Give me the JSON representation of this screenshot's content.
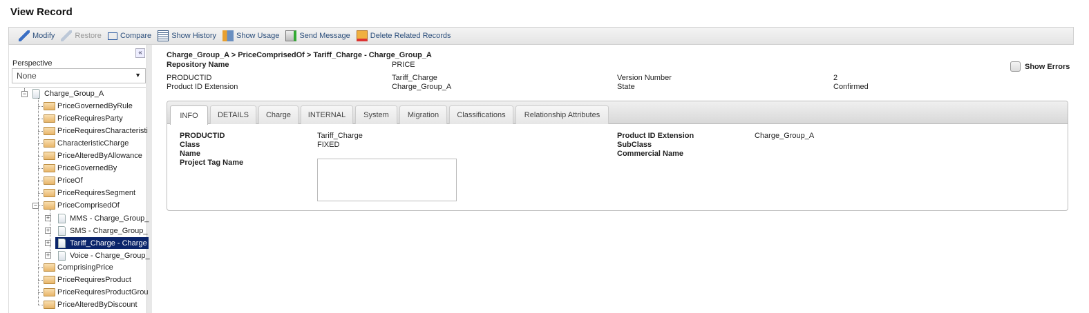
{
  "title": "View Record",
  "toolbar": [
    {
      "label": "Modify",
      "icon": "pencil-icon",
      "enabled": true
    },
    {
      "label": "Restore",
      "icon": "pencil-disabled-icon",
      "enabled": false
    },
    {
      "label": "Compare",
      "icon": "compare-icon",
      "enabled": true
    },
    {
      "label": "Show History",
      "icon": "history-icon",
      "enabled": true
    },
    {
      "label": "Show Usage",
      "icon": "usage-icon",
      "enabled": true
    },
    {
      "label": "Send Message",
      "icon": "send-message-icon",
      "enabled": true
    },
    {
      "label": "Delete Related Records",
      "icon": "delete-records-icon",
      "enabled": true
    }
  ],
  "sidebar": {
    "collapse": "«",
    "perspective_label": "Perspective",
    "perspective_value": "None",
    "tree": {
      "root": "Charge_Group_A",
      "children": [
        "PriceGovernedByRule",
        "PriceRequiresParty",
        "PriceRequiresCharacteristi",
        "CharacteristicCharge",
        "PriceAlteredByAllowance",
        "PriceGovernedBy",
        "PriceOf",
        "PriceRequiresSegment",
        "PriceComprisedOf",
        "ComprisingPrice",
        "PriceRequiresProduct",
        "PriceRequiresProductGrou",
        "PriceAlteredByDiscount"
      ],
      "comprised": [
        "MMS - Charge_Group_",
        "SMS - Charge_Group_",
        "Tariff_Charge - Charge",
        "Voice - Charge_Group_"
      ],
      "selected": "Tariff_Charge - Charge"
    }
  },
  "header": {
    "breadcrumb": "Charge_Group_A > PriceComprisedOf > Tariff_Charge - Charge_Group_A",
    "repo_label": "Repository Name",
    "repo_value": "PRICE",
    "pid_label": "PRODUCTID",
    "pid_value": "Tariff_Charge",
    "pidext_label": "Product ID Extension",
    "pidext_value": "Charge_Group_A",
    "version_label": "Version Number",
    "version_value": "2",
    "state_label": "State",
    "state_value": "Confirmed",
    "show_errors": "Show Errors"
  },
  "tabs": [
    "INFO",
    "DETAILS",
    "Charge",
    "INTERNAL",
    "System",
    "Migration",
    "Classifications",
    "Relationship Attributes"
  ],
  "info": {
    "pid_label": "PRODUCTID",
    "pid_value": "Tariff_Charge",
    "class_label": "Class",
    "class_value": "FIXED",
    "name_label": "Name",
    "tag_label": "Project Tag Name",
    "pidext_label": "Product ID Extension",
    "pidext_value": "Charge_Group_A",
    "subclass_label": "SubClass",
    "commercial_label": "Commercial Name"
  }
}
